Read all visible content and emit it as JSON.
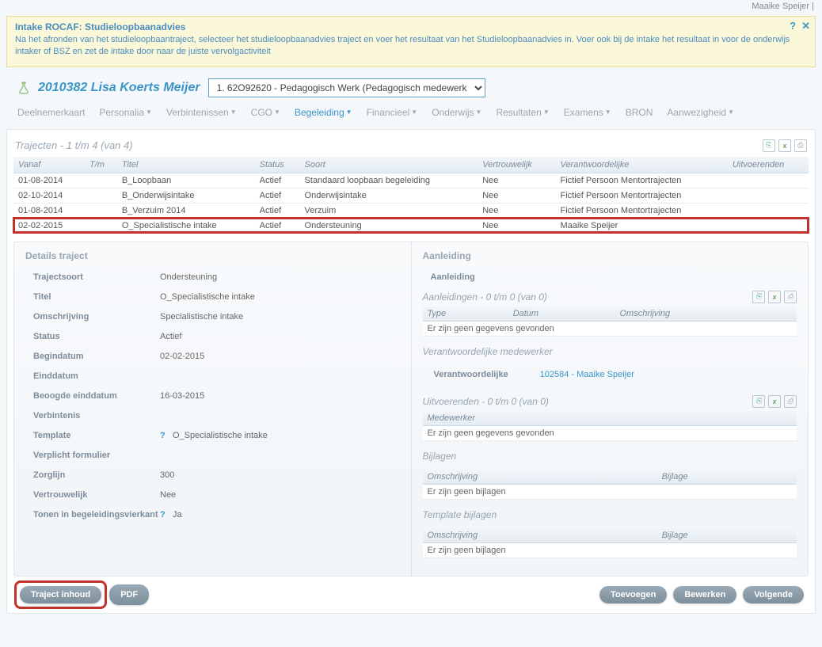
{
  "user_name": "Maaike Speijer |",
  "notice": {
    "title": "Intake ROCAF: Studieloopbaanadvies",
    "body": "Na het afronden van het studieloopbaantraject, selecteer het studieloopbaanadvies traject en voer het resultaat van het Studieloopbaanadvies in. Voer ook bij de intake het resultaat in voor de onderwijs intaker of BSZ en zet de intake door naar de juiste vervolgactiviteit"
  },
  "student": {
    "id_name": "2010382 Lisa Koerts Meijer",
    "programme": "1. 62O92620 - Pedagogisch Werk (Pedagogisch medewerk"
  },
  "tabs": [
    {
      "label": "Deelnemerkaart",
      "caret": false
    },
    {
      "label": "Personalia",
      "caret": true
    },
    {
      "label": "Verbintenissen",
      "caret": true
    },
    {
      "label": "CGO",
      "caret": true
    },
    {
      "label": "Begeleiding",
      "caret": true,
      "active": true
    },
    {
      "label": "Financieel",
      "caret": true
    },
    {
      "label": "Onderwijs",
      "caret": true
    },
    {
      "label": "Resultaten",
      "caret": true
    },
    {
      "label": "Examens",
      "caret": true
    },
    {
      "label": "BRON",
      "caret": false
    },
    {
      "label": "Aanwezigheid",
      "caret": true
    }
  ],
  "traject_list": {
    "title": "Trajecten - 1 t/m 4 (van 4)",
    "cols": [
      "Vanaf",
      "T/m",
      "Titel",
      "Status",
      "Soort",
      "Vertrouwelijk",
      "Verantwoordelijke",
      "Uitvoerenden"
    ],
    "rows": [
      {
        "vanaf": "01-08-2014",
        "tm": "",
        "titel": "B_Loopbaan",
        "status": "Actief",
        "soort": "Standaard loopbaan begeleiding",
        "vertr": "Nee",
        "verantw": "Fictief Persoon Mentortrajecten",
        "uitv": ""
      },
      {
        "vanaf": "02-10-2014",
        "tm": "",
        "titel": "B_Onderwijsintake",
        "status": "Actief",
        "soort": "Onderwijsintake",
        "vertr": "Nee",
        "verantw": "Fictief Persoon Mentortrajecten",
        "uitv": ""
      },
      {
        "vanaf": "01-08-2014",
        "tm": "",
        "titel": "B_Verzuim 2014",
        "status": "Actief",
        "soort": "Verzuim",
        "vertr": "Nee",
        "verantw": "Fictief Persoon Mentortrajecten",
        "uitv": ""
      },
      {
        "vanaf": "02-02-2015",
        "tm": "",
        "titel": "O_Specialistische intake",
        "status": "Actief",
        "soort": "Ondersteuning",
        "vertr": "Nee",
        "verantw": "Maaike Speijer",
        "uitv": "",
        "hl": true
      }
    ]
  },
  "details": {
    "head": "Details traject",
    "trajsoort": {
      "label": "Trajectsoort",
      "value": "Ondersteuning"
    },
    "titel": {
      "label": "Titel",
      "value": "O_Specialistische intake"
    },
    "omschr": {
      "label": "Omschrijving",
      "value": "Specialistische intake"
    },
    "status": {
      "label": "Status",
      "value": "Actief"
    },
    "begin": {
      "label": "Begindatum",
      "value": "02-02-2015"
    },
    "eind": {
      "label": "Einddatum",
      "value": ""
    },
    "beoogd": {
      "label": "Beoogde einddatum",
      "value": "16-03-2015"
    },
    "verbint": {
      "label": "Verbintenis",
      "value": ""
    },
    "template": {
      "label": "Template",
      "value": "O_Specialistische intake",
      "help": true
    },
    "verpl": {
      "label": "Verplicht formulier",
      "value": ""
    },
    "zorg": {
      "label": "Zorglijn",
      "value": "300"
    },
    "vertr": {
      "label": "Vertrouwelijk",
      "value": "Nee"
    },
    "tonen": {
      "label": "Tonen in begeleidingsvierkant",
      "value": "Ja",
      "help": true
    }
  },
  "aanl": {
    "head": "Aanleiding",
    "sub": "Aanleiding",
    "list_title": "Aanleidingen - 0 t/m 0 (van 0)",
    "cols": [
      "Type",
      "Datum",
      "Omschrijving"
    ],
    "empty": "Er zijn geen gegevens gevonden"
  },
  "verantw": {
    "head": "Verantwoordelijke medewerker",
    "label": "Verantwoordelijke",
    "value": "102584 - Maaike Speijer"
  },
  "uitv": {
    "title": "Uitvoerenden - 0 t/m 0 (van 0)",
    "col": "Medewerker",
    "empty": "Er zijn geen gegevens gevonden"
  },
  "bijl": {
    "head": "Bijlagen",
    "cols": [
      "Omschrijving",
      "Bijlage"
    ],
    "empty": "Er zijn geen bijlagen"
  },
  "tmplbijl": {
    "head": "Template bijlagen",
    "cols": [
      "Omschrijving",
      "Bijlage"
    ],
    "empty": "Er zijn geen bijlagen"
  },
  "buttons": {
    "traject": "Traject inhoud",
    "pdf": "PDF",
    "toevoegen": "Toevoegen",
    "bewerken": "Bewerken",
    "volgende": "Volgende"
  }
}
